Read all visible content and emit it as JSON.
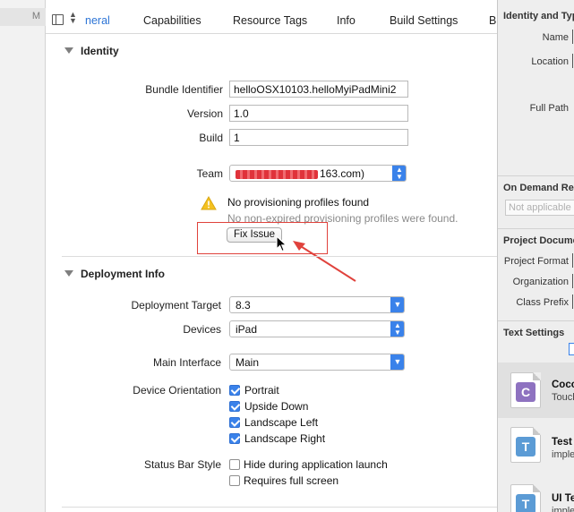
{
  "left_strip": {
    "label": "M"
  },
  "tabs": [
    {
      "label": "neral",
      "active": true
    },
    {
      "label": "Capabilities"
    },
    {
      "label": "Resource Tags"
    },
    {
      "label": "Info"
    },
    {
      "label": "Build Settings"
    },
    {
      "label": "B"
    }
  ],
  "identity": {
    "heading": "Identity",
    "bundle_identifier_label": "Bundle Identifier",
    "bundle_identifier_value": "helloOSX10103.helloMyiPadMini2",
    "version_label": "Version",
    "version_value": "1.0",
    "build_label": "Build",
    "build_value": "1",
    "team_label": "Team",
    "team_value_visible": "163.com)",
    "warning_title": "No provisioning profiles found",
    "warning_detail": "No non-expired provisioning profiles were found.",
    "fix_button": "Fix Issue"
  },
  "deployment": {
    "heading": "Deployment Info",
    "target_label": "Deployment Target",
    "target_value": "8.3",
    "devices_label": "Devices",
    "devices_value": "iPad",
    "main_interface_label": "Main Interface",
    "main_interface_value": "Main",
    "orientation_label": "Device Orientation",
    "orientations": [
      {
        "label": "Portrait",
        "checked": true
      },
      {
        "label": "Upside Down",
        "checked": true
      },
      {
        "label": "Landscape Left",
        "checked": true
      },
      {
        "label": "Landscape Right",
        "checked": true
      }
    ],
    "status_bar_label": "Status Bar Style",
    "status_bar_options": [
      {
        "label": "Hide during application launch",
        "checked": false
      },
      {
        "label": "Requires full screen",
        "checked": false
      }
    ]
  },
  "inspector": {
    "identity_heading": "Identity and Typ",
    "name_label": "Name",
    "location_label": "Location",
    "full_path_label": "Full Path",
    "on_demand_heading": "On Demand Res",
    "on_demand_placeholder": "Not applicable",
    "project_doc_heading": "Project Docume",
    "project_format_label": "Project Format",
    "organization_label": "Organization",
    "class_prefix_label": "Class Prefix",
    "text_settings_heading": "Text Settings",
    "library": [
      {
        "title": "Coco",
        "subtitle": "Touch",
        "badge": "C",
        "badge_color": "#8e72c0"
      },
      {
        "title": "Test",
        "subtitle": "imple",
        "badge": "T",
        "badge_color": "#5b9bd5"
      },
      {
        "title": "UI Te",
        "subtitle": "imple",
        "badge": "T",
        "badge_color": "#5b9bd5"
      }
    ]
  },
  "colors": {
    "accent": "#3a82ea",
    "annotation_red": "#e0423c",
    "warning_yellow": "#f4c11f"
  }
}
